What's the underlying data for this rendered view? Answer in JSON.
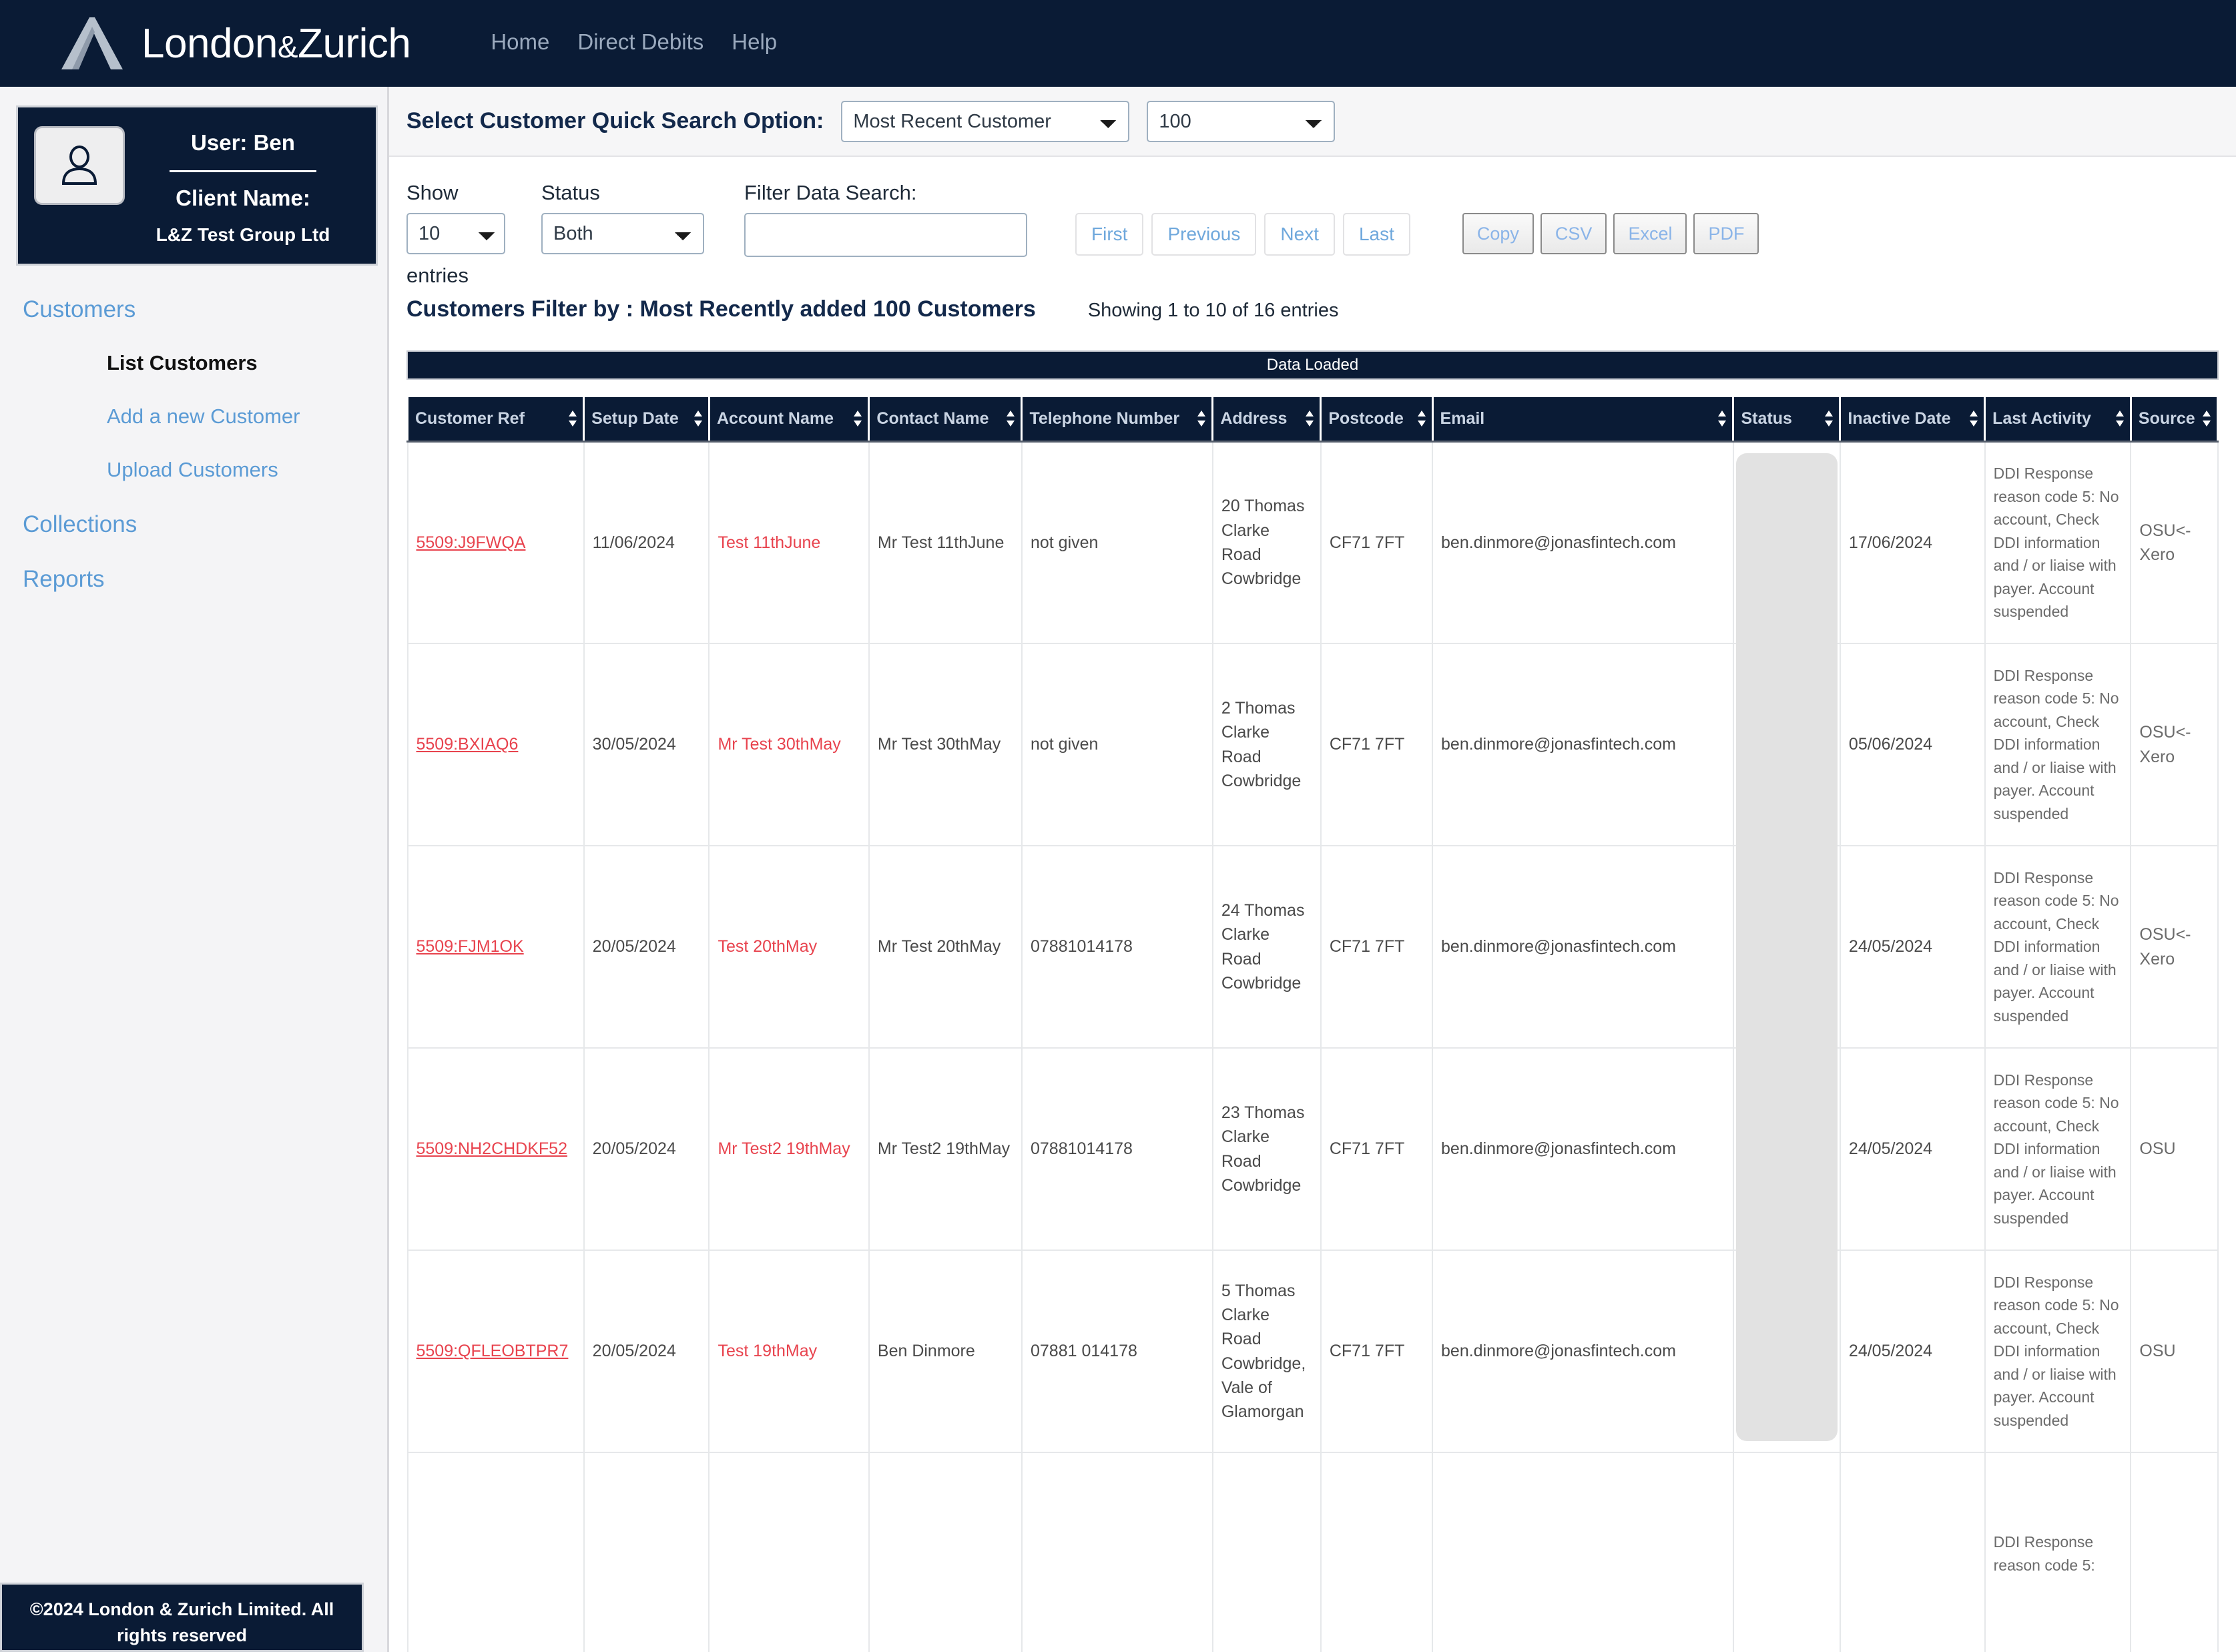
{
  "brand": {
    "name_main": "London",
    "name_amp": "&",
    "name_second": "Zurich",
    "logo_icon": "chevron-logo-icon"
  },
  "topnav": {
    "items": [
      {
        "label": "Home"
      },
      {
        "label": "Direct Debits"
      },
      {
        "label": "Help"
      }
    ]
  },
  "sidebar": {
    "avatar_icon": "user-avatar-icon",
    "user_line": "User: Ben",
    "client_label": "Client Name:",
    "client_name": "L&Z Test Group Ltd",
    "nav": [
      {
        "label": "Customers",
        "type": "top",
        "active": false
      },
      {
        "label": "List Customers",
        "type": "sub",
        "active": true
      },
      {
        "label": "Add a new Customer",
        "type": "sub",
        "active": false
      },
      {
        "label": "Upload Customers",
        "type": "sub",
        "active": false
      },
      {
        "label": "Collections",
        "type": "top",
        "active": false
      },
      {
        "label": "Reports",
        "type": "top",
        "active": false
      }
    ],
    "footer": "©2024 London & Zurich Limited. All rights reserved"
  },
  "quickbar": {
    "label": "Select Customer Quick Search Option:",
    "option_select": {
      "value": "Most Recent Customer",
      "options": [
        "Most Recent Customer"
      ]
    },
    "count_select": {
      "value": "100",
      "options": [
        "100"
      ]
    }
  },
  "controls": {
    "show_label": "Show",
    "show_select": {
      "value": "10",
      "options": [
        "10"
      ]
    },
    "entries_word": "entries",
    "status_label": "Status",
    "status_select": {
      "value": "Both",
      "options": [
        "Both"
      ]
    },
    "filter_label": "Filter Data Search:",
    "filter_value": "",
    "filter_placeholder": "",
    "pager": [
      {
        "label": "First"
      },
      {
        "label": "Previous"
      },
      {
        "label": "Next"
      },
      {
        "label": "Last"
      }
    ],
    "exports": [
      {
        "label": "Copy"
      },
      {
        "label": "CSV"
      },
      {
        "label": "Excel"
      },
      {
        "label": "PDF"
      }
    ]
  },
  "summary": {
    "filter_title": "Customers Filter by : Most Recently added 100 Customers",
    "showing": "Showing 1 to 10 of 16 entries",
    "load_status": "Data Loaded"
  },
  "table": {
    "columns": [
      {
        "key": "ref",
        "label": "Customer Ref",
        "sortable": true
      },
      {
        "key": "setup",
        "label": "Setup Date",
        "sortable": true
      },
      {
        "key": "account",
        "label": "Account Name",
        "sortable": true
      },
      {
        "key": "contact",
        "label": "Contact Name",
        "sortable": true
      },
      {
        "key": "phone",
        "label": "Telephone Number",
        "sortable": true
      },
      {
        "key": "address",
        "label": "Address",
        "sortable": true
      },
      {
        "key": "postcode",
        "label": "Postcode",
        "sortable": true
      },
      {
        "key": "email",
        "label": "Email",
        "sortable": true
      },
      {
        "key": "status",
        "label": "Status",
        "sortable": true
      },
      {
        "key": "inactive",
        "label": "Inactive Date",
        "sortable": true
      },
      {
        "key": "activity",
        "label": "Last Activity",
        "sortable": true
      },
      {
        "key": "source",
        "label": "Source",
        "sortable": true
      }
    ],
    "rows": [
      {
        "ref": "5509:J9FWQA",
        "setup": "11/06/2024",
        "account": "Test 11thJune",
        "contact": "Mr Test 11thJune",
        "phone": "not given",
        "address": "20 Thomas Clarke Road Cowbridge",
        "postcode": "CF71 7FT",
        "email": "ben.dinmore@jonasfintech.com",
        "status": "",
        "inactive": "17/06/2024",
        "activity": "DDI Response reason code 5: No account, Check DDI information and / or liaise with payer. Account suspended",
        "source": "OSU<-Xero"
      },
      {
        "ref": "5509:BXIAQ6",
        "setup": "30/05/2024",
        "account": "Mr Test 30thMay",
        "contact": "Mr Test 30thMay",
        "phone": "not given",
        "address": "2 Thomas Clarke Road Cowbridge",
        "postcode": "CF71 7FT",
        "email": "ben.dinmore@jonasfintech.com",
        "status": "",
        "inactive": "05/06/2024",
        "activity": "DDI Response reason code 5: No account, Check DDI information and / or liaise with payer. Account suspended",
        "source": "OSU<-Xero"
      },
      {
        "ref": "5509:FJM1OK",
        "setup": "20/05/2024",
        "account": "Test 20thMay",
        "contact": "Mr Test 20thMay",
        "phone": "07881014178",
        "address": "24 Thomas Clarke Road Cowbridge",
        "postcode": "CF71 7FT",
        "email": "ben.dinmore@jonasfintech.com",
        "status": "",
        "inactive": "24/05/2024",
        "activity": "DDI Response reason code 5: No account, Check DDI information and / or liaise with payer. Account suspended",
        "source": "OSU<-Xero"
      },
      {
        "ref": "5509:NH2CHDKF52",
        "setup": "20/05/2024",
        "account": "Mr Test2 19thMay",
        "contact": "Mr Test2 19thMay",
        "phone": "07881014178",
        "address": "23 Thomas Clarke Road Cowbridge",
        "postcode": "CF71 7FT",
        "email": "ben.dinmore@jonasfintech.com",
        "status": "",
        "inactive": "24/05/2024",
        "activity": "DDI Response reason code 5: No account, Check DDI information and / or liaise with payer. Account suspended",
        "source": "OSU"
      },
      {
        "ref": "5509:QFLEOBTPR7",
        "setup": "20/05/2024",
        "account": "Test 19thMay",
        "contact": "Ben Dinmore",
        "phone": "07881 014178",
        "address": "5 Thomas Clarke Road Cowbridge, Vale of Glamorgan",
        "postcode": "CF71 7FT",
        "email": "ben.dinmore@jonasfintech.com",
        "status": "",
        "inactive": "24/05/2024",
        "activity": "DDI Response reason code 5: No account, Check DDI information and / or liaise with payer. Account suspended",
        "source": "OSU"
      },
      {
        "ref": "",
        "setup": "",
        "account": "",
        "contact": "",
        "phone": "",
        "address": "",
        "postcode": "",
        "email": "",
        "status": "",
        "inactive": "",
        "activity": "DDI Response reason code 5:",
        "source": ""
      }
    ]
  },
  "colors": {
    "navy": "#0a1b35",
    "link_blue": "#5b9bd5",
    "accent_red": "#e8434e",
    "panel_grey": "#f4f4f6"
  }
}
